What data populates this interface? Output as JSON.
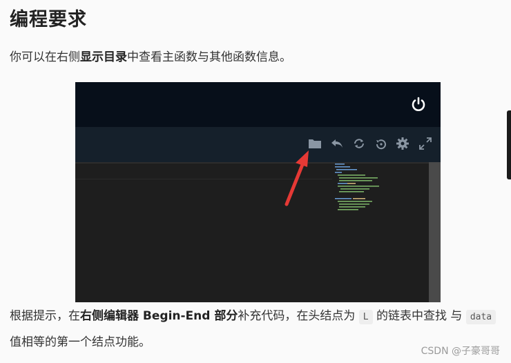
{
  "heading": "编程要求",
  "intro": {
    "prefix": "你可以在右侧",
    "bold": "显示目录",
    "suffix": "中查看主函数与其他函数信息。"
  },
  "screenshot": {
    "icons": [
      "power-icon",
      "folder-icon",
      "undo-icon",
      "refresh-icon",
      "restore-icon",
      "gear-icon",
      "expand-icon"
    ],
    "colors": {
      "topbar": "#070f1a",
      "toolbar": "#15202b",
      "editor": "#1e1e1e",
      "arrow": "#e53935"
    }
  },
  "paragraph": {
    "part1": "根据提示，在",
    "bold1": "右侧编辑器 Begin-End 部分",
    "part2": "补充代码，在头结点为",
    "code1": "L",
    "part3": "的链表中查找 与",
    "code2": "data",
    "part4": "值相等的第一个结点功能。"
  },
  "watermark": "CSDN @子豪哥哥"
}
